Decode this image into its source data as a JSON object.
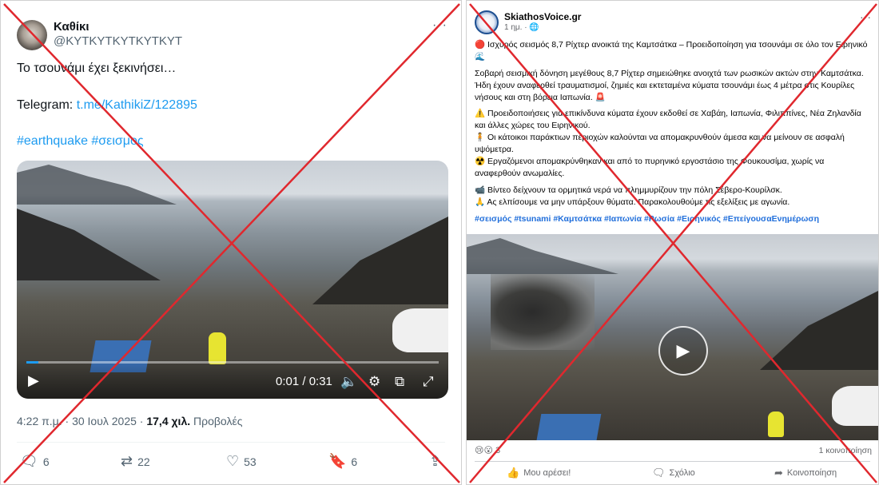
{
  "tweet": {
    "name": "Καθίκι",
    "handle": "@KYTKYTKYTKYTKYT",
    "more": "···",
    "text_line1": "Το τσουνάμι έχει ξεκινήσει…",
    "telegram_label": "Telegram: ",
    "telegram_link": "t.me/KathikiZ/122895",
    "hashtags": "#earthquake #σεισμος",
    "video": {
      "time": "0:01 / 0:31",
      "progress": 0.03
    },
    "meta_date": "4:22 π.μ. · 30 Ιουλ 2025 · ",
    "meta_views_count": "17,4 χιλ.",
    "meta_views_label": " Προβολές",
    "actions": {
      "replies": "6",
      "retweets": "22",
      "likes": "53",
      "bookmarks": "6"
    }
  },
  "fb_post": {
    "page_name": "SkiathosVoice.gr",
    "time": "1 ημ. · ",
    "time_icon": "globe-icon",
    "more": "···",
    "headline": "🔴 Ισχυρός σεισμός 8,7 Ρίχτερ ανοικτά της Καμτσάτκα – Προειδοποίηση για τσουνάμι σε όλο τον Ειρηνικό 🌊",
    "para1": "Σοβαρή σεισμική δόνηση μεγέθους 8,7 Ρίχτερ σημειώθηκε ανοιχτά των ρωσικών ακτών στην Καμτσάτκα. Ήδη έχουν αναφερθεί τραυματισμοί, ζημιές και εκτεταμένα κύματα τσουνάμι έως 4 μέτρα στις Κουρίλες νήσους και στη βόρεια Ιαπωνία. 🚨",
    "bullet1": "⚠️ Προειδοποιήσεις για επικίνδυνα κύματα έχουν εκδοθεί σε Χαβάη, Ιαπωνία, Φιλιππίνες, Νέα Ζηλανδία και άλλες χώρες του Ειρηνικού.",
    "bullet2": "🧍 Οι κάτοικοι παράκτιων περιοχών καλούνται να απομακρυνθούν άμεσα και να μείνουν σε ασφαλή υψόμετρα.",
    "bullet3": "☢️ Εργαζόμενοι απομακρύνθηκαν και από το πυρηνικό εργοστάσιο της Φουκουσίμα, χωρίς να αναφερθούν ανωμαλίες.",
    "bullet4": "📹 Βίντεο δείχνουν τα ορμητικά νερά να πλημμυρίζουν την πόλη Σέβερο-Κουρίλσκ.",
    "bullet5": "🙏 Ας ελπίσουμε να μην υπάρξουν θύματα. Παρακολουθούμε τις εξελίξεις με αγωνία.",
    "hashtags": "#σεισμός #tsunami #Καμτσάτκα #Ιαπωνία #Ρωσία #Ειρηνικός #ΕπείγουσαΕνημέρωση",
    "reactions_emoji": "😢😮",
    "reactions_count": "3",
    "shares": "1 κοινοποίηση",
    "actions": {
      "like": "Μου αρέσει!",
      "comment": "Σχόλιο",
      "share": "Κοινοποίηση"
    }
  },
  "colors": {
    "x_mark": "#e0282e",
    "twitter_link": "#1d9bf0",
    "fb_link": "#216fdb"
  }
}
